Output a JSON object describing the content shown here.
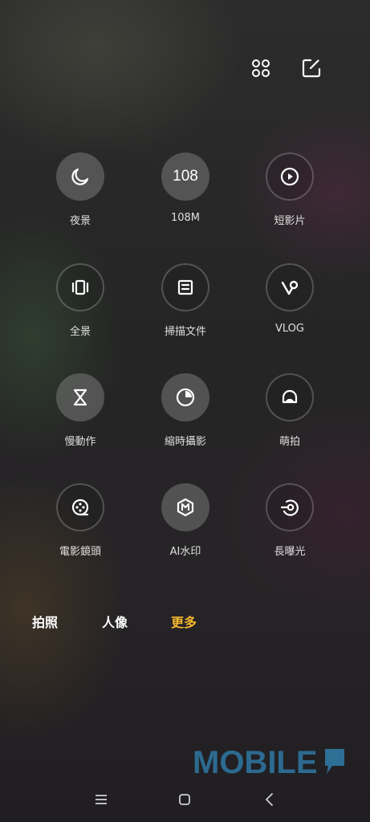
{
  "toolbar": {
    "grid_icon": "grid-icon",
    "edit_icon": "edit-icon"
  },
  "modes": [
    {
      "label": "夜景",
      "icon": "moon-icon",
      "style": "filled"
    },
    {
      "label": "108M",
      "icon": "108-text",
      "text": "108",
      "style": "filled"
    },
    {
      "label": "短影片",
      "icon": "play-icon",
      "style": "outline"
    },
    {
      "label": "全景",
      "icon": "panorama-icon",
      "style": "outline"
    },
    {
      "label": "掃描文件",
      "icon": "document-scan-icon",
      "style": "outline"
    },
    {
      "label": "VLOG",
      "icon": "vlog-icon",
      "style": "outline"
    },
    {
      "label": "慢動作",
      "icon": "hourglass-icon",
      "style": "filled"
    },
    {
      "label": "縮時攝影",
      "icon": "timelapse-icon",
      "style": "filled"
    },
    {
      "label": "萌拍",
      "icon": "cute-face-icon",
      "style": "outline"
    },
    {
      "label": "電影鏡頭",
      "icon": "film-reel-icon",
      "style": "outline"
    },
    {
      "label": "AI水印",
      "icon": "watermark-m-icon",
      "style": "filled"
    },
    {
      "label": "長曝光",
      "icon": "long-exposure-icon",
      "style": "outline"
    }
  ],
  "tabs": [
    {
      "label": "拍照",
      "active": false
    },
    {
      "label": "人像",
      "active": false
    },
    {
      "label": "更多",
      "active": true
    }
  ],
  "watermark": {
    "text": "MOBILE"
  },
  "colors": {
    "accent": "#f5b82e",
    "watermark": "#2e6f96"
  },
  "navbar": {
    "icons": [
      "menu-icon",
      "home-icon",
      "back-icon"
    ]
  }
}
